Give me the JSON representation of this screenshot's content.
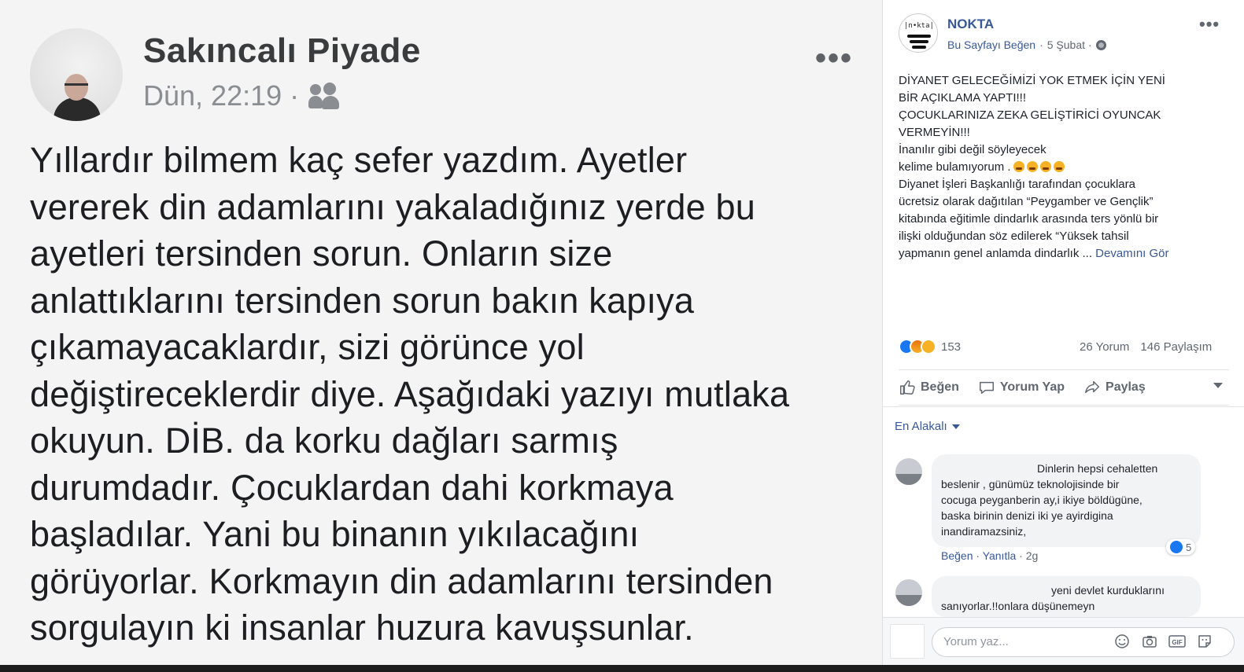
{
  "photo_post": {
    "author": "Sakıncalı Piyade",
    "time": "Dün, 22:19 ·",
    "more": "•••",
    "lines": [
      "Yıllardır bilmem kaç sefer yazdım. Ayetler",
      "vererek din adamlarını yakaladığınız yerde bu",
      "ayetleri tersinden sorun. Onların size",
      "anlattıklarını tersinden sorun bakın kapıya",
      "çıkamayacaklardır, sizi görünce yol",
      "değiştireceklerdir diye. Aşağıdaki yazıyı mutlaka",
      "okuyun. DİB. da korku dağları sarmış",
      "durumdadır. Çocuklardan dahi korkmaya",
      "başladılar. Yani bu binanın yıkılacağını",
      "görüyorlar. Korkmayın din adamlarını tersinden",
      "sorgulayın ki insanlar huzura kavuşsunlar."
    ]
  },
  "page": {
    "logo_text": "|n•kta|",
    "name": "NOKTA",
    "like_page": "Bu Sayfayı Beğen",
    "sep": "·",
    "date": "5 Şubat ·",
    "more": "•••"
  },
  "post": {
    "lines": [
      "DİYANET GELECEĞİMİZİ YOK ETMEK İÇİN YENİ",
      "BİR AÇIKLAMA YAPTI!!!",
      "ÇOCUKLARINIZA ZEKA GELİŞTİRİCİ OYUNCAK",
      "VERMEYİN!!!",
      "İnanılır gibi değil söyleyecek",
      "kelime bulamıyorum .",
      "Diyanet İşleri Başkanlığı tarafından çocuklara",
      "ücretsiz olarak dağıtılan “Peygamber ve Gençlik”",
      "kitabında eğitimle dindarlık arasında ters yönlü bir",
      "ilişki olduğundan söz edilerek “Yüksek tahsil",
      "yapmanın genel anlamda dindarlık ..."
    ],
    "more_link": "Devamını Gör",
    "emoji_count": 4
  },
  "stats": {
    "reactions": "153",
    "comments": "26 Yorum",
    "shares": "146 Paylaşım",
    "reaction_colors": [
      "#1877f2",
      "#e9710f",
      "#f7b125"
    ]
  },
  "actions": {
    "like": "Beğen",
    "comment": "Yorum Yap",
    "share": "Paylaş"
  },
  "filter": "En Alakalı",
  "comments": [
    {
      "lines": [
        "Dinlerin hepsi cehaletten",
        "beslenir , günümüz teknolojisinde bir",
        "cocuga peyganberin ay,i ikiye böldügüne,",
        "baska birinin denizi iki ye ayirdigina",
        "inandiramazsiniz,"
      ],
      "likes": "5",
      "like": "Beğen",
      "reply": "Yanıtla",
      "age": "2g"
    },
    {
      "lines": [
        "yeni devlet kurduklarını",
        "sanıyorlar.!!onlara düşünemeyn"
      ]
    }
  ],
  "compose": {
    "placeholder": "Yorum yaz...",
    "icons": [
      "emoji-icon",
      "camera-icon",
      "gif-icon",
      "sticker-icon"
    ]
  },
  "colors": {
    "link": "#385898",
    "accent": "#1877f2",
    "muted": "#606770"
  }
}
